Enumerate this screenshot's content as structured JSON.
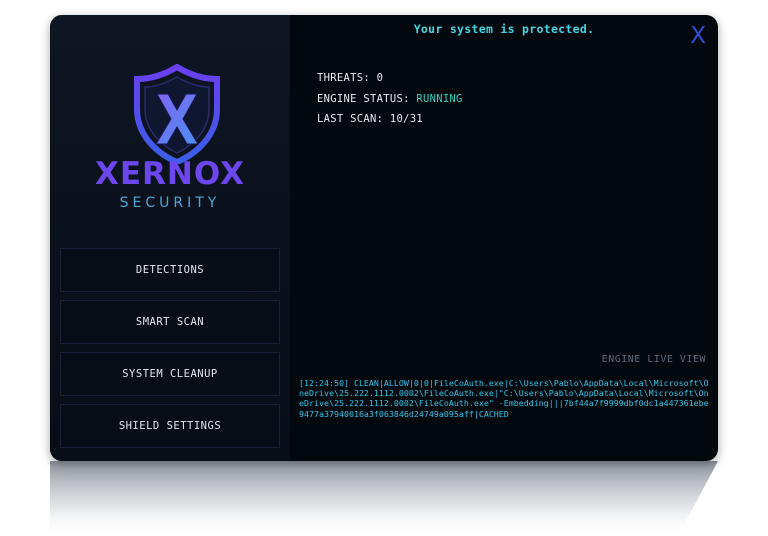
{
  "header": {
    "status_title": "Your system is protected.",
    "close_label": "X"
  },
  "brand": {
    "name": "XERNOX",
    "tagline": "SECURITY",
    "shield_letter": "X",
    "colors": {
      "primary": "#6c47ee",
      "secondary": "#4fa5d8",
      "accent": "#2ed3c1"
    }
  },
  "sidebar": {
    "items": [
      {
        "label": "DETECTIONS"
      },
      {
        "label": "SMART SCAN"
      },
      {
        "label": "SYSTEM CLEANUP"
      },
      {
        "label": "SHIELD SETTINGS"
      }
    ]
  },
  "stats": {
    "threats_label": "THREATS:",
    "threats_value": "0",
    "engine_label": "ENGINE STATUS:",
    "engine_value": "RUNNING",
    "scan_label": "LAST SCAN:",
    "scan_value": "10/31"
  },
  "live": {
    "title": "ENGINE LIVE VIEW",
    "log": "[12:24:50] CLEAN|ALLOW|0|0|FileCoAuth.exe|C:\\Users\\Pablo\\AppData\\Local\\Microsoft\\OneDrive\\25.222.1112.0002\\FileCoAuth.exe|\"C:\\Users\\Pablo\\AppData\\Local\\Microsoft\\OneDrive\\25.222.1112.0002\\FileCoAuth.exe\" -Embedding|||7bf44a7f9999dbf0dc1a447361ebe9477a37940016a3f063846d24749a095aff|CACHED"
  }
}
